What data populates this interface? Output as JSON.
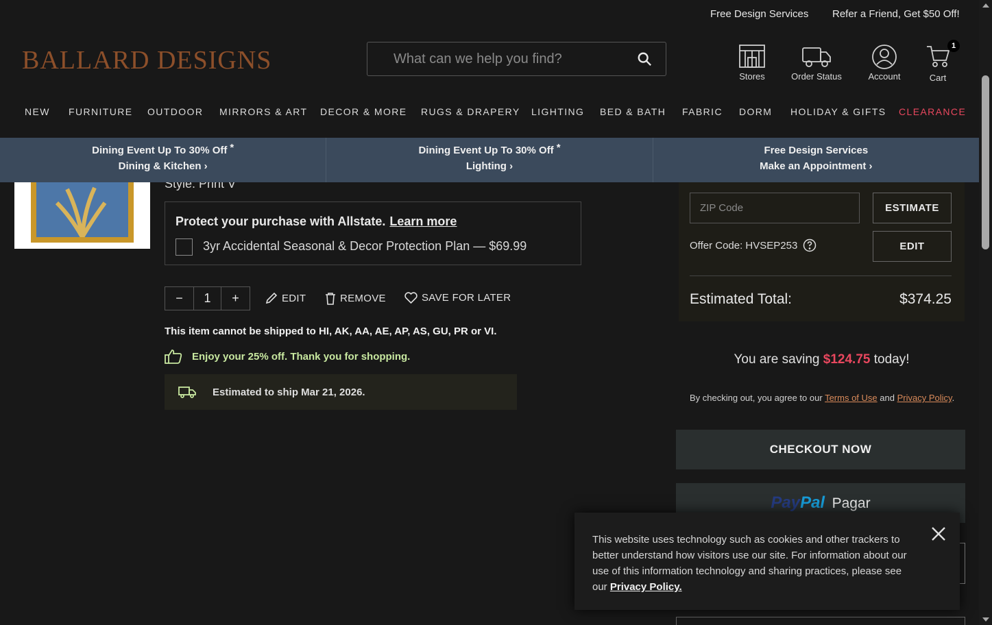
{
  "util": {
    "design": "Free Design Services",
    "refer": "Refer a Friend, Get $50 Off!"
  },
  "brand": {
    "logo": "BALLARD DESIGNS"
  },
  "search": {
    "placeholder": "What can we help you find?"
  },
  "header": {
    "stores": "Stores",
    "order_status": "Order Status",
    "account": "Account",
    "cart": "Cart",
    "cart_count": "1"
  },
  "nav": [
    "NEW",
    "FURNITURE",
    "OUTDOOR",
    "MIRRORS & ART",
    "DECOR & MORE",
    "RUGS & DRAPERY",
    "LIGHTING",
    "BED & BATH",
    "FABRIC",
    "DORM",
    "HOLIDAY & GIFTS",
    "CLEARANCE"
  ],
  "promo": [
    {
      "line1": "Dining Event Up To 30% Off",
      "mark": "*",
      "line2": "Dining & Kitchen ›"
    },
    {
      "line1": "Dining Event Up To 30% Off",
      "mark": "*",
      "line2": "Lighting ›"
    },
    {
      "line1": "Free Design Services",
      "mark": "",
      "line2": "Make an Appointment ›"
    }
  ],
  "item": {
    "style": "Style: Print V",
    "protect_title": "Protect your purchase with Allstate.",
    "learn_more": "Learn more",
    "plan": "3yr Accidental Seasonal & Decor Protection Plan  — $69.99",
    "qty": "1",
    "minus": "−",
    "plus": "+",
    "edit": "EDIT",
    "remove": "REMOVE",
    "save_later": "SAVE FOR LATER",
    "ship_note": "This item cannot be shipped to HI, AK, AA, AE, AP, AS, GU, PR or VI.",
    "enjoy": "Enjoy your 25% off. Thank you for shopping.",
    "est_ship": "Estimated to ship Mar 21, 2026."
  },
  "summary": {
    "zip_placeholder": "ZIP Code",
    "estimate": "ESTIMATE",
    "offer_code": "Offer Code: HVSEP253",
    "edit": "EDIT",
    "est_total_label": "Estimated Total:",
    "est_total_value": "$374.25",
    "saving_pre": "You are saving",
    "saving_amt": "$124.75",
    "saving_post": "today!",
    "terms_pre": "By checking out, you agree to our",
    "terms_link": "Terms of Use",
    "terms_and": "and",
    "privacy_link": "Privacy Policy",
    "terms_end": ".",
    "checkout": "CHECKOUT NOW",
    "paypal_pay": "Pay",
    "paypal_pal": "Pal",
    "paypal_pagar": "Pagar"
  },
  "cookie": {
    "text": "This website uses technology such as cookies and other trackers to better understand how visitors use our site. For information about our use of this information technology and sharing practices, please see our",
    "link": "Privacy Policy."
  },
  "colors": {
    "accent_red": "#e8475e",
    "logo_brown": "#8c4f2a",
    "promo_bg": "#3b4a5c",
    "enjoy_green": "#c8e8a0"
  },
  "icons": [
    "search-icon",
    "store-icon",
    "truck-icon",
    "account-icon",
    "cart-icon",
    "pencil-icon",
    "trash-icon",
    "heart-icon",
    "thumbs-up-icon",
    "delivery-truck-icon",
    "help-icon",
    "close-icon"
  ]
}
